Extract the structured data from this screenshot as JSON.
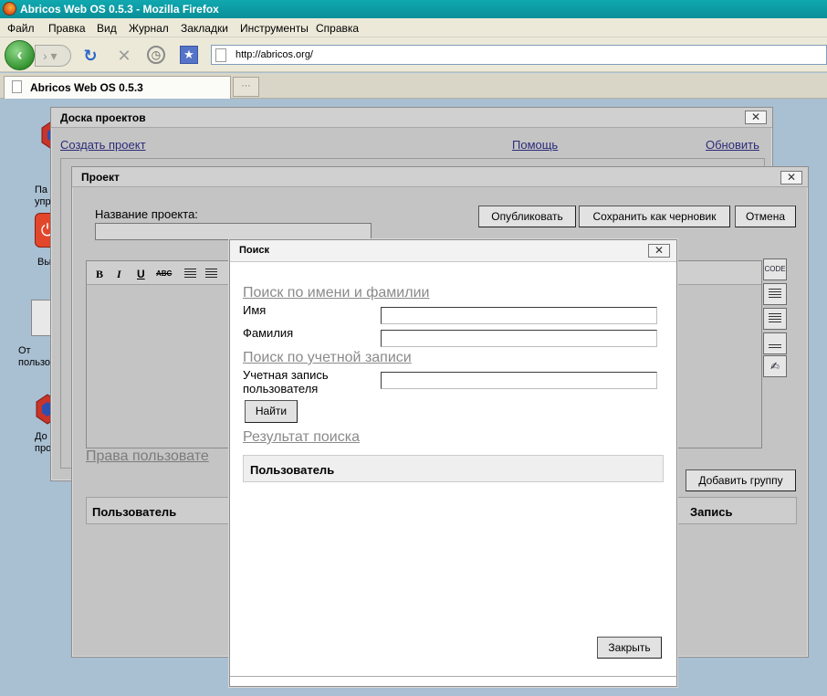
{
  "browser": {
    "window_title": "Abricos Web OS 0.5.3 - Mozilla Firefox",
    "menu": [
      "Файл",
      "Правка",
      "Вид",
      "Журнал",
      "Закладки",
      "Инструменты",
      "Справка"
    ],
    "url": "http://abricos.org/",
    "tab_label": "Abricos Web OS 0.5.3"
  },
  "desktop_icons": [
    {
      "label": "Па\nупра",
      "icon": "control-panel-icon"
    },
    {
      "label": "Вы",
      "icon": "exit-icon"
    },
    {
      "label": "От\nпользо",
      "icon": "reports-icon"
    },
    {
      "label": "До\nпро",
      "icon": "project-board-icon"
    }
  ],
  "board_window": {
    "title": "Доска проектов",
    "create_link": "Создать проект",
    "help_link": "Помощь",
    "refresh_link": "Обновить"
  },
  "project_window": {
    "title": "Проект",
    "name_label": "Название проекта:",
    "publish": "Опубликовать",
    "save_draft": "Сохранить как черновик",
    "cancel": "Отмена",
    "toolbar": {
      "bold": "B",
      "italic": "I",
      "underline": "U",
      "strike": "ABC"
    },
    "code_btn": "CODE",
    "rights_header": "Права пользовате",
    "add_group": "Добавить группу",
    "col_user": "Пользователь",
    "col_account": "Запись"
  },
  "search_dialog": {
    "title": "Поиск",
    "by_name_header": "Поиск по имени и фамилии",
    "first_name_label": "Имя",
    "last_name_label": "Фамилия",
    "by_account_header": "Поиск по учетной записи",
    "account_label": "Учетная запись пользователя",
    "find_button": "Найти",
    "result_header": "Результат поиска",
    "result_col_user": "Пользователь",
    "close_button": "Закрыть"
  }
}
